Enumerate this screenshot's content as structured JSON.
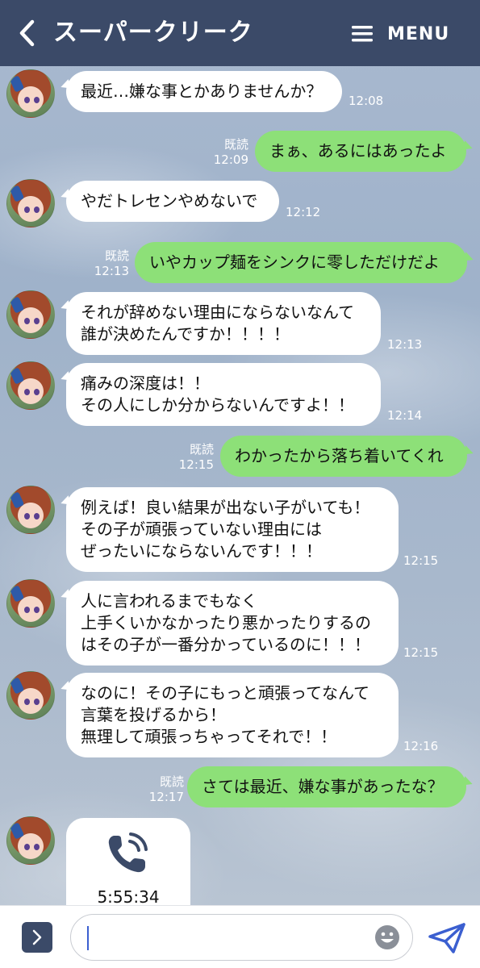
{
  "header": {
    "title": "スーパークリーク",
    "menu_label": "MENU"
  },
  "messages": [
    {
      "dir": "in",
      "text": "最近…嫌な事とかありませんか？",
      "time": "12:08"
    },
    {
      "dir": "out",
      "text": "まぁ、あるにはあったよ",
      "read": "既読",
      "time": "12:09"
    },
    {
      "dir": "in",
      "text": "やだトレセンやめないで",
      "time": "12:12"
    },
    {
      "dir": "out",
      "text": "いやカップ麺をシンクに零しただけだよ",
      "read": "既読",
      "time": "12:13"
    },
    {
      "dir": "in",
      "text": "それが辞めない理由にならないなんて\n誰が決めたんですか！！！！",
      "time": "12:13"
    },
    {
      "dir": "in",
      "text": "痛みの深度は！！\nその人にしか分からないんですよ！！",
      "time": "12:14"
    },
    {
      "dir": "out",
      "text": "わかったから落ち着いてくれ",
      "read": "既読",
      "time": "12:15"
    },
    {
      "dir": "in",
      "text": "例えば！良い結果が出ない子がいても！\nその子が頑張っていない理由には\nぜったいにならないんです！！！",
      "time": "12:15"
    },
    {
      "dir": "in",
      "text": "人に言われるまでもなく\n上手くいかなかったり悪かったりするの\nはその子が一番分かっているのに！！！",
      "time": "12:15"
    },
    {
      "dir": "in",
      "text": "なのに！その子にもっと頑張ってなんて\n言葉を投げるから！\n無理して頑張っちゃってそれで！！",
      "time": "12:16"
    },
    {
      "dir": "out",
      "text": "さては最近、嫌な事があったな？",
      "read": "既読",
      "time": "12:17"
    }
  ],
  "call": {
    "duration": "5:55:34",
    "icon": "phone-call-icon"
  },
  "composer": {
    "value": "",
    "placeholder": ""
  },
  "colors": {
    "header": "#3b4a68",
    "outgoing": "#8de078",
    "incoming": "#ffffff",
    "send": "#3b5fd0"
  }
}
